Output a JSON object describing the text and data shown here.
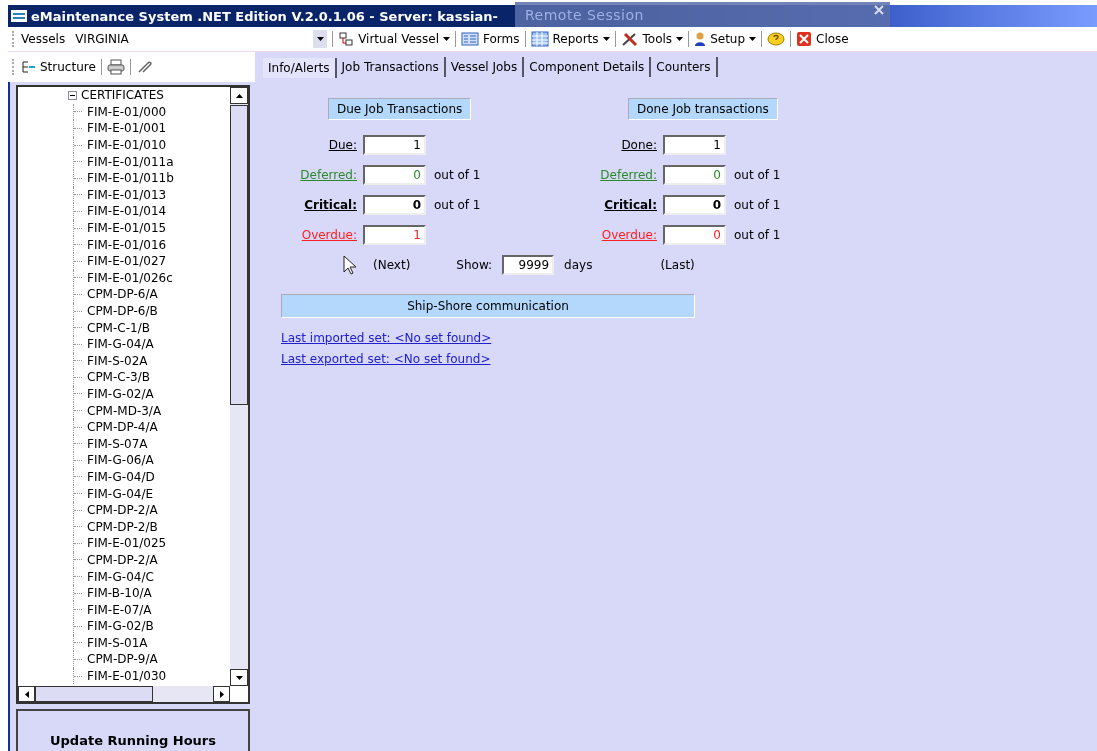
{
  "window": {
    "title": "eMaintenance System .NET Edition V.2.0.1.06 - Server: kassian-",
    "overlay": "Remote Session"
  },
  "toolbar": {
    "vessel_label": "Vessels",
    "vessel_value": "VIRGINIA",
    "items": [
      {
        "kind": "vessel",
        "label": "Virtual Vessel",
        "dropdown": true
      },
      {
        "kind": "forms",
        "label": "Forms",
        "dropdown": false
      },
      {
        "kind": "reports",
        "label": "Reports",
        "dropdown": true
      },
      {
        "kind": "tools",
        "label": "Tools",
        "dropdown": true
      },
      {
        "kind": "setup",
        "label": "Setup",
        "dropdown": true
      },
      {
        "kind": "help",
        "dropdown": false
      },
      {
        "kind": "close",
        "label": "Close",
        "dropdown": false
      }
    ]
  },
  "side_toolbar": {
    "structure": "Structure"
  },
  "tree": {
    "label": "CERTIFICATES",
    "expanded": true,
    "children": [
      {
        "label": "FIM-E-01/000"
      },
      {
        "label": "FIM-E-01/001"
      },
      {
        "label": "FIM-E-01/010"
      },
      {
        "label": "FIM-E-01/011a"
      },
      {
        "label": "FIM-E-01/011b"
      },
      {
        "label": "FIM-E-01/013"
      },
      {
        "label": "FIM-E-01/014"
      },
      {
        "label": "FIM-E-01/015"
      },
      {
        "label": "FIM-E-01/016"
      },
      {
        "label": "FIM-E-01/027"
      },
      {
        "label": "FIM-E-01/026c"
      },
      {
        "label": "CPM-DP-6/A"
      },
      {
        "label": "CPM-DP-6/B"
      },
      {
        "label": "CPM-C-1/B"
      },
      {
        "label": "FIM-G-04/A"
      },
      {
        "label": "FIM-S-02A"
      },
      {
        "label": "CPM-C-3/B"
      },
      {
        "label": "FIM-G-02/A"
      },
      {
        "label": "CPM-MD-3/A"
      },
      {
        "label": "CPM-DP-4/A"
      },
      {
        "label": "FIM-S-07A"
      },
      {
        "label": "FIM-G-06/A"
      },
      {
        "label": "FIM-G-04/D"
      },
      {
        "label": "FIM-G-04/E"
      },
      {
        "label": "CPM-DP-2/A"
      },
      {
        "label": "CPM-DP-2/B"
      },
      {
        "label": "FIM-E-01/025"
      },
      {
        "label": "CPM-DP-2/A"
      },
      {
        "label": "FIM-G-04/C"
      },
      {
        "label": "FIM-B-10/A"
      },
      {
        "label": "FIM-E-07/A"
      },
      {
        "label": "FIM-G-02/B"
      },
      {
        "label": "FIM-S-01A"
      },
      {
        "label": "CPM-DP-9/A"
      },
      {
        "label": "FIM-E-01/030"
      }
    ]
  },
  "update_button": "Update Running Hours",
  "tabs": [
    {
      "label": "Info/Alerts",
      "selected": true
    },
    {
      "label": "Job Transactions",
      "selected": false
    },
    {
      "label": "Vessel Jobs",
      "selected": false
    },
    {
      "label": "Component Details",
      "selected": false
    },
    {
      "label": "Counters",
      "selected": false
    }
  ],
  "groups": [
    {
      "title": "Due Job Transactions",
      "rows": [
        {
          "kind": "total",
          "label": "Due:",
          "value": "1"
        },
        {
          "kind": "deferred",
          "label": "Deferred:",
          "value": "0",
          "suffix": "out of 1"
        },
        {
          "kind": "critical",
          "label": "Critical:",
          "value": "0",
          "suffix": "out of 1"
        },
        {
          "kind": "overdue",
          "label": "Overdue:",
          "value": "1"
        }
      ]
    },
    {
      "title": "Done Job transactions",
      "rows": [
        {
          "kind": "total",
          "label": "Done:",
          "value": "1"
        },
        {
          "kind": "deferred",
          "label": "Deferred:",
          "value": "0",
          "suffix": "out of 1"
        },
        {
          "kind": "critical",
          "label": "Critical:",
          "value": "0",
          "suffix": "out of 1"
        },
        {
          "kind": "overdue",
          "label": "Overdue:",
          "value": "0",
          "suffix": "out of 1"
        }
      ]
    }
  ],
  "range": {
    "next": "(Next)",
    "show_label": "Show:",
    "show_value": "9999",
    "unit": "days",
    "last": "(Last)"
  },
  "communication": {
    "title": "Ship-Shore communication",
    "links": [
      "Last imported set: <No set found>",
      "Last exported set: <No set found>"
    ]
  }
}
